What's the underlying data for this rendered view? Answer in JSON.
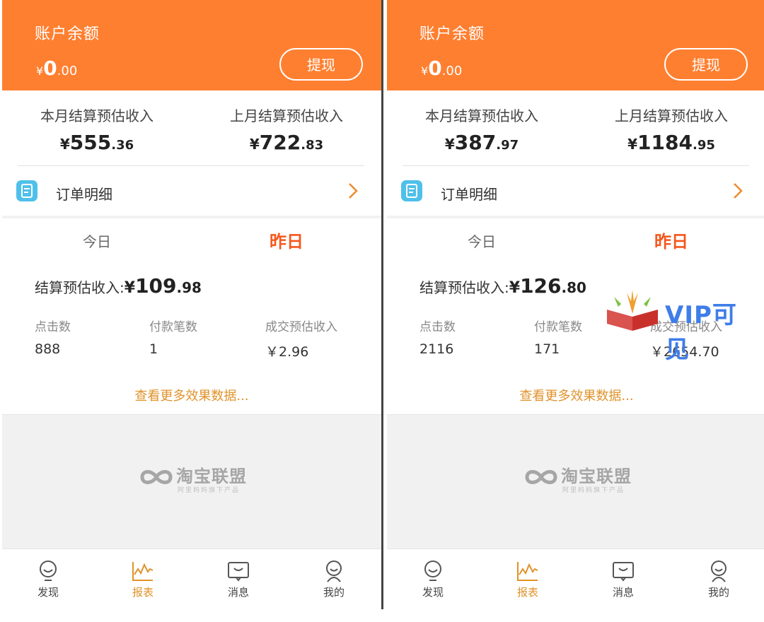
{
  "panels": [
    {
      "header": {
        "balance_label": "账户余额",
        "currency": "¥",
        "balance_int": "0",
        "balance_dec": ".00",
        "withdraw_label": "提现"
      },
      "summary": {
        "this_month_label": "本月结算预估收入",
        "this_month_currency": "¥",
        "this_month_int": "555",
        "this_month_dec": ".36",
        "last_month_label": "上月结算预估收入",
        "last_month_currency": "¥",
        "last_month_int": "722",
        "last_month_dec": ".83"
      },
      "order_detail_label": "订单明细",
      "tabs": {
        "today": "今日",
        "yesterday": "昨日"
      },
      "settle": {
        "label": "结算预估收入:",
        "currency": "¥",
        "int": "109",
        "dec": ".98"
      },
      "stats": {
        "clicks_label": "点击数",
        "clicks_value": "888",
        "payments_label": "付款笔数",
        "payments_value": "1",
        "deal_label": "成交预估收入",
        "deal_value": "￥2.96"
      },
      "more_link": "查看更多效果数据...",
      "logo": {
        "text": "淘宝联盟",
        "sub": "阿里妈妈旗下产品"
      },
      "nav": [
        {
          "label": "发现",
          "icon": "bulb-icon"
        },
        {
          "label": "报表",
          "icon": "chart-icon",
          "active": true
        },
        {
          "label": "消息",
          "icon": "message-icon"
        },
        {
          "label": "我的",
          "icon": "user-icon"
        }
      ]
    },
    {
      "header": {
        "balance_label": "账户余额",
        "currency": "¥",
        "balance_int": "0",
        "balance_dec": ".00",
        "withdraw_label": "提现"
      },
      "summary": {
        "this_month_label": "本月结算预估收入",
        "this_month_currency": "¥",
        "this_month_int": "387",
        "this_month_dec": ".97",
        "last_month_label": "上月结算预估收入",
        "last_month_currency": "¥",
        "last_month_int": "1184",
        "last_month_dec": ".95"
      },
      "order_detail_label": "订单明细",
      "tabs": {
        "today": "今日",
        "yesterday": "昨日"
      },
      "settle": {
        "label": "结算预估收入:",
        "currency": "¥",
        "int": "126",
        "dec": ".80"
      },
      "stats": {
        "clicks_label": "点击数",
        "clicks_value": "2116",
        "payments_label": "付款笔数",
        "payments_value": "171",
        "deal_label": "成交预估收入",
        "deal_value": "￥2654.70"
      },
      "more_link": "查看更多效果数据...",
      "logo": {
        "text": "淘宝联盟",
        "sub": "阿里妈妈旗下产品"
      },
      "nav": [
        {
          "label": "发现",
          "icon": "bulb-icon"
        },
        {
          "label": "报表",
          "icon": "chart-icon",
          "active": true
        },
        {
          "label": "消息",
          "icon": "message-icon"
        },
        {
          "label": "我的",
          "icon": "user-icon"
        }
      ]
    }
  ],
  "watermark": {
    "text": "VIP可见"
  },
  "colors": {
    "header": "#ff7f30",
    "accent": "#f4581d",
    "link": "#e0922a",
    "watermark": "#3f7de8"
  }
}
